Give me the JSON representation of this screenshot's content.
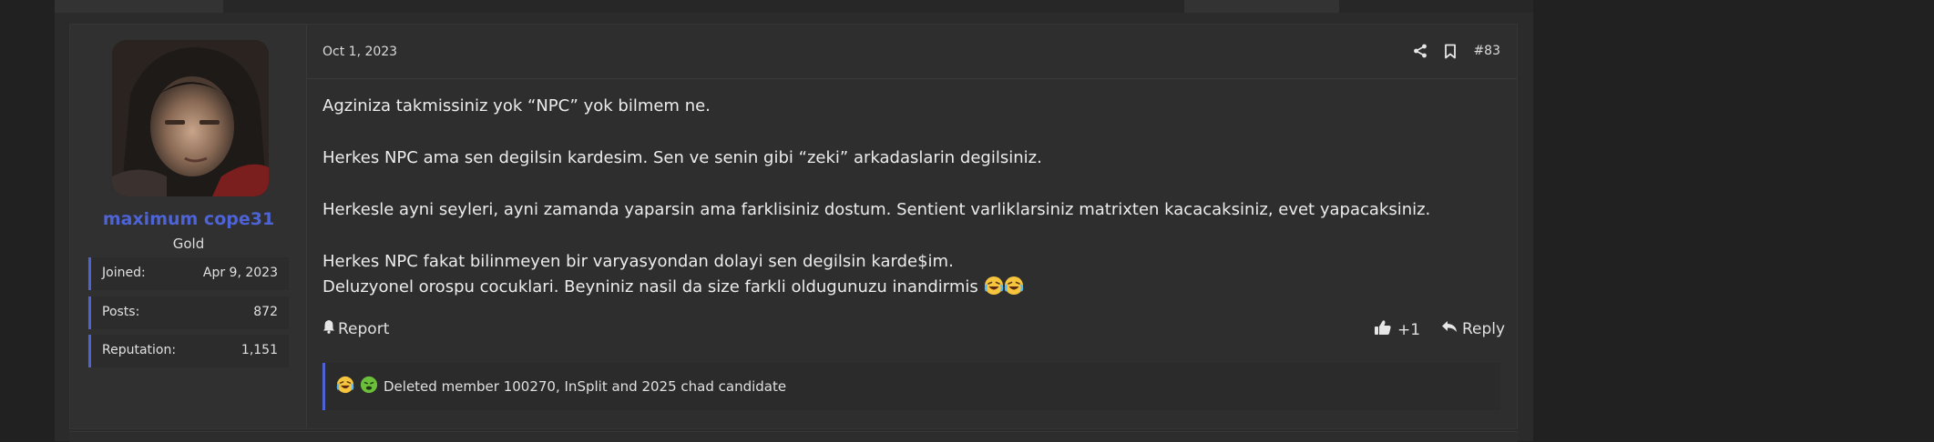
{
  "post": {
    "date": "Oct 1, 2023",
    "number": "#83",
    "user": {
      "name": "maximum cope31",
      "title": "Gold",
      "stats": [
        {
          "label": "Joined:",
          "value": "Apr 9, 2023"
        },
        {
          "label": "Posts:",
          "value": "872"
        },
        {
          "label": "Reputation:",
          "value": "1,151"
        }
      ]
    },
    "body": {
      "p1": "Agziniza takmissiniz yok “NPC” yok bilmem ne.",
      "p2": "Herkes NPC ama sen degilsin kardesim. Sen ve senin gibi “zeki” arkadaslarin degilsiniz.",
      "p3": "Herkesle ayni seyleri, ayni zamanda yaparsin ama farklisiniz dostum. Sentient varliklarsiniz matrixten kacacaksiniz, evet yapacaksiniz.",
      "p4_line1": "Herkes NPC fakat bilinmeyen bir varyasyondan dolayi sen degilsin karde$im.",
      "p4_line2": "Deluzyonel orospu cocuklari. Beyniniz nasil da size farkli oldugunuzu inandirmis"
    },
    "footer": {
      "report_label": "Report",
      "reaction_count": "+1",
      "reply_label": "Reply"
    },
    "reactions_text": "Deleted member 100270, InSplit and 2025 chad candidate"
  },
  "icons": {
    "share": "share-icon",
    "bookmark": "bookmark-icon",
    "bell": "bell-icon",
    "thumbs_up": "thumbs-up-icon",
    "reply": "reply-arrow-icon",
    "emoji_laugh_cry": "loudly-crying-laugh-emoji",
    "emoji_nauseated": "nauseated-face-emoji"
  },
  "colors": {
    "accent": "#4d63d6",
    "background": "#222222",
    "panel": "#2e2e2e"
  }
}
